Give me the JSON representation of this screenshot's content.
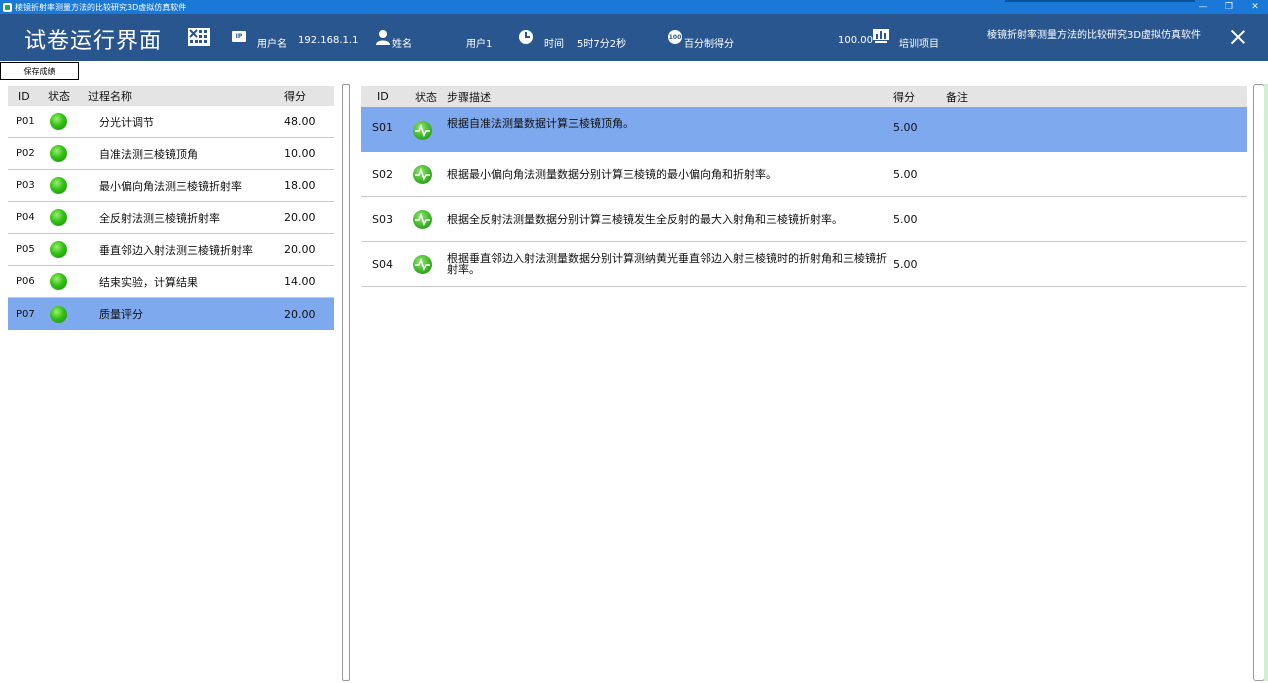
{
  "window": {
    "title": "棱镜折射率测量方法的比较研究3D虚拟仿真软件",
    "minimize": "—",
    "restore": "❐",
    "close": "✕"
  },
  "header": {
    "title": "试卷运行界面",
    "ip_icon_text": "IP",
    "ip_label": "用户名",
    "ip_value": "192.168.1.1",
    "name_label": "姓名",
    "user_value": "用户1",
    "time_label": "时间",
    "time_value": "5时7分2秒",
    "score_icon_text": "100",
    "score_label": "百分制得分",
    "score_value": "100.00",
    "training_label": "培训项目",
    "project_value": "棱镜折射率测量方法的比较研究3D虚拟仿真软件"
  },
  "toolbar": {
    "save_label": "保存成绩"
  },
  "process_table": {
    "headers": {
      "id": "ID",
      "state": "状态",
      "name": "过程名称",
      "score": "得分"
    },
    "rows": [
      {
        "id": "P01",
        "name": "分光计调节",
        "score": "48.00"
      },
      {
        "id": "P02",
        "name": "自准法测三棱镜顶角",
        "score": "10.00"
      },
      {
        "id": "P03",
        "name": "最小偏向角法测三棱镜折射率",
        "score": "18.00"
      },
      {
        "id": "P04",
        "name": "全反射法测三棱镜折射率",
        "score": "20.00"
      },
      {
        "id": "P05",
        "name": "垂直邻边入射法测三棱镜折射率",
        "score": "20.00"
      },
      {
        "id": "P06",
        "name": "结束实验，计算结果",
        "score": "14.00"
      },
      {
        "id": "P07",
        "name": "质量评分",
        "score": "20.00"
      }
    ]
  },
  "step_table": {
    "headers": {
      "id": "ID",
      "state": "状态",
      "desc": "步骤描述",
      "score": "得分",
      "note": "备注"
    },
    "rows": [
      {
        "id": "S01",
        "desc": "根据自准法测量数据计算三棱镜顶角。",
        "score": "5.00",
        "note": ""
      },
      {
        "id": "S02",
        "desc": "根据最小偏向角法测量数据分别计算三棱镜的最小偏向角和折射率。",
        "score": "5.00",
        "note": ""
      },
      {
        "id": "S03",
        "desc": "根据全反射法测量数据分别计算三棱镜发生全反射的最大入射角和三棱镜折射率。",
        "score": "5.00",
        "note": ""
      },
      {
        "id": "S04",
        "desc": "根据垂直邻边入射法测量数据分别计算测纳黄光垂直邻边入射三棱镜时的折射角和三棱镜折射率。",
        "score": "5.00",
        "note": ""
      }
    ]
  }
}
